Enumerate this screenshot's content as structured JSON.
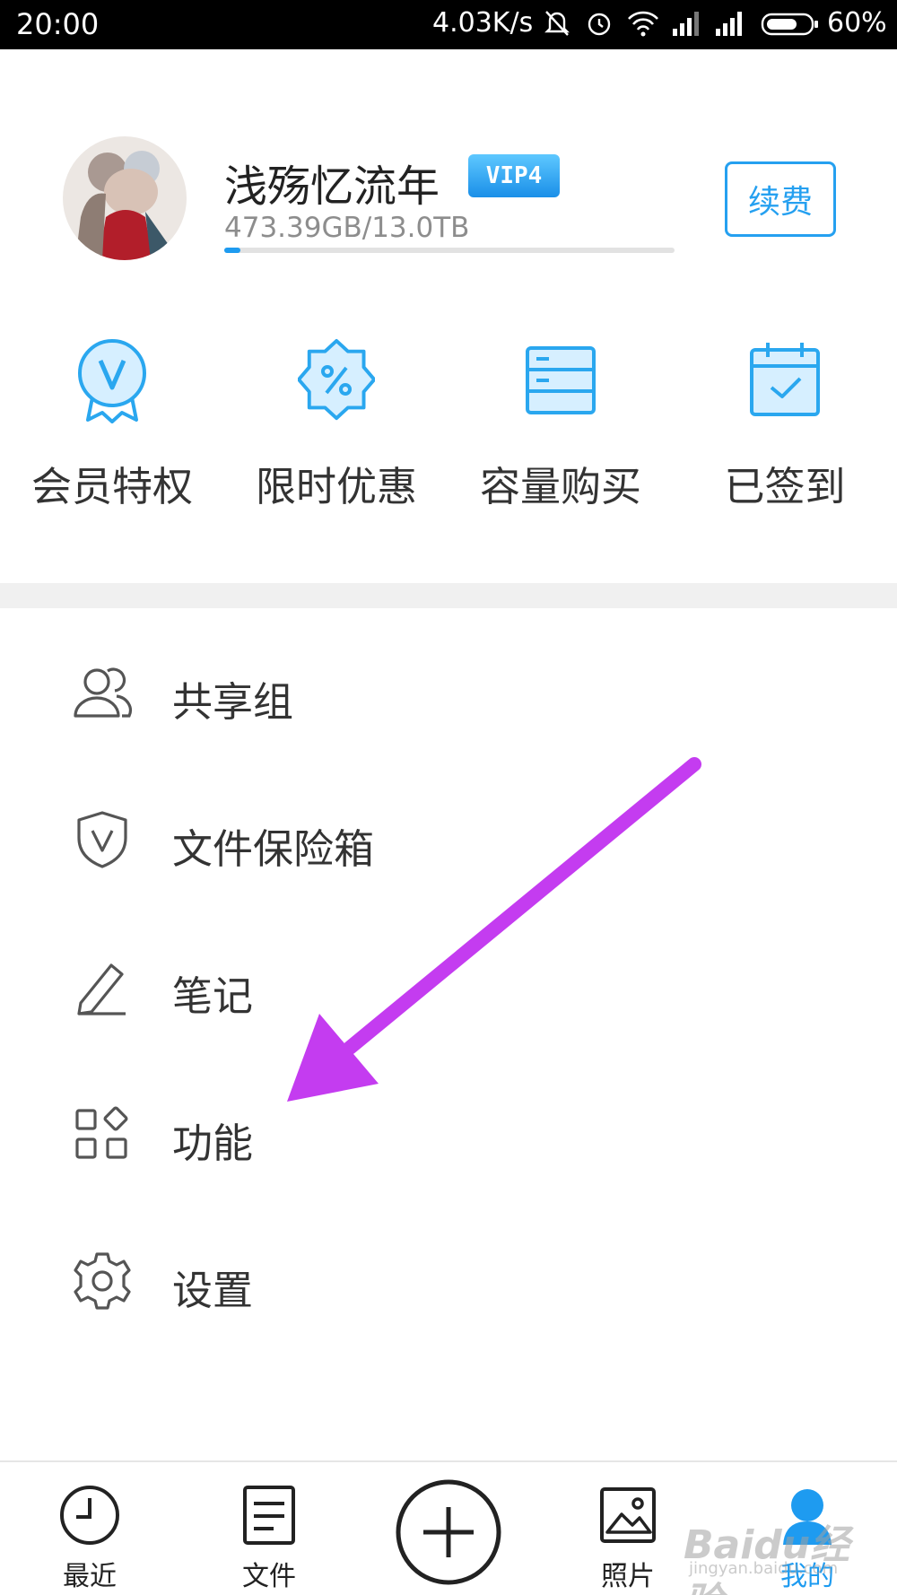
{
  "status_bar": {
    "time": "20:00",
    "speed": "4.03K/s",
    "battery": "60%"
  },
  "profile": {
    "username": "浅殇忆流年",
    "vip_badge": "VIP4",
    "storage_text": "473.39GB/13.0TB",
    "storage_used_fraction": 0.035,
    "renew_label": "续费"
  },
  "quick_actions": [
    {
      "label": "会员特权",
      "icon": "vip-medal-icon"
    },
    {
      "label": "限时优惠",
      "icon": "discount-badge-icon"
    },
    {
      "label": "容量购买",
      "icon": "storage-server-icon"
    },
    {
      "label": "已签到",
      "icon": "calendar-check-icon"
    }
  ],
  "menu": [
    {
      "label": "共享组",
      "icon": "people-icon"
    },
    {
      "label": "文件保险箱",
      "icon": "shield-icon"
    },
    {
      "label": "笔记",
      "icon": "pencil-icon"
    },
    {
      "label": "功能",
      "icon": "grid-icon"
    },
    {
      "label": "设置",
      "icon": "gear-icon"
    }
  ],
  "bottom_nav": {
    "recent": "最近",
    "files": "文件",
    "photos": "照片",
    "mine": "我的"
  },
  "watermark": {
    "line1": "Baidu经验",
    "line2": "jingyan.baidu.com"
  },
  "colors": {
    "accent": "#1e9bf0",
    "annotation_arrow": "#c43cf0"
  }
}
